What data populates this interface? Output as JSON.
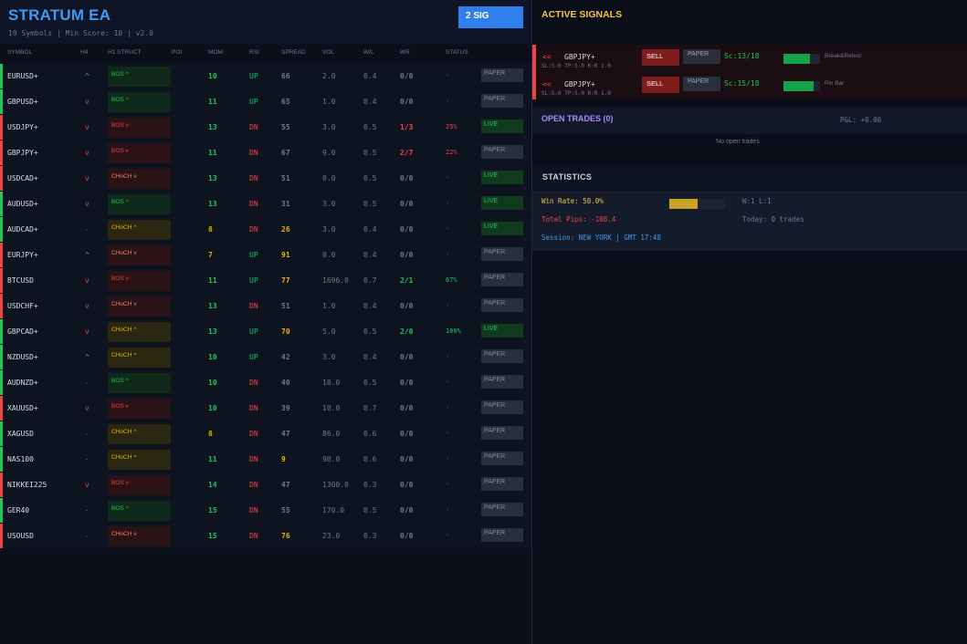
{
  "header": {
    "title": "STRATUM EA",
    "subtitle": "19 Symbols | Min Score: 10 | v2.0",
    "signal_badge": "2 SIG"
  },
  "columns": [
    "SYMBOL",
    "H4",
    "H1 STRUCT",
    "POI",
    "MOM",
    "RSI",
    "SPREAD",
    "VOL",
    "W/L",
    "WR",
    "STATUS"
  ],
  "rows": [
    {
      "symbol": "EURUSD+",
      "h4": "^",
      "struct": "BOS ^",
      "mom": "10",
      "rsi": "UP",
      "spread": "66",
      "vol": "2.0",
      "wl": "0.4",
      "wr": "0/0",
      "pct": "-",
      "status": "PAPER"
    },
    {
      "symbol": "GBPUSD+",
      "h4": "v",
      "struct": "BOS ^",
      "mom": "11",
      "rsi": "UP",
      "spread": "65",
      "vol": "1.0",
      "wl": "0.4",
      "wr": "0/0",
      "pct": "-",
      "status": "PAPER"
    },
    {
      "symbol": "USDJPY+",
      "h4": "v",
      "struct": "BOS v",
      "mom": "13",
      "rsi": "DN",
      "spread": "55",
      "vol": "3.0",
      "wl": "0.5",
      "wr": "1/3",
      "pct": "25%",
      "status": "LIVE"
    },
    {
      "symbol": "GBPJPY+",
      "h4": "v",
      "struct": "BOS v",
      "mom": "11",
      "rsi": "DN",
      "spread": "67",
      "vol": "9.0",
      "wl": "0.5",
      "wr": "2/7",
      "pct": "22%",
      "status": "PAPER"
    },
    {
      "symbol": "USDCAD+",
      "h4": "v",
      "struct": "CHoCH v",
      "mom": "13",
      "rsi": "DN",
      "spread": "51",
      "vol": "0.0",
      "wl": "0.5",
      "wr": "0/0",
      "pct": "-",
      "status": "LIVE"
    },
    {
      "symbol": "AUDUSD+",
      "h4": "v",
      "struct": "BOS ^",
      "mom": "13",
      "rsi": "DN",
      "spread": "31",
      "vol": "3.0",
      "wl": "0.5",
      "wr": "0/0",
      "pct": "-",
      "status": "LIVE"
    },
    {
      "symbol": "AUDCAD+",
      "h4": "-",
      "struct": "CHoCH ^",
      "mom": "8",
      "rsi": "DN",
      "spread": "26",
      "vol": "3.0",
      "wl": "0.4",
      "wr": "0/0",
      "pct": "-",
      "status": "LIVE"
    },
    {
      "symbol": "EURJPY+",
      "h4": "^",
      "struct": "CHoCH v",
      "mom": "7",
      "rsi": "UP",
      "spread": "91",
      "vol": "0.0",
      "wl": "0.4",
      "wr": "0/0",
      "pct": "-",
      "status": "PAPER"
    },
    {
      "symbol": "BTCUSD",
      "h4": "v",
      "struct": "BOS v",
      "mom": "11",
      "rsi": "UP",
      "spread": "77",
      "vol": "1696.0",
      "wl": "0.7",
      "wr": "2/1",
      "pct": "67%",
      "status": "PAPER"
    },
    {
      "symbol": "USDCHF+",
      "h4": "v",
      "struct": "CHoCH v",
      "mom": "13",
      "rsi": "DN",
      "spread": "51",
      "vol": "1.0",
      "wl": "0.4",
      "wr": "0/0",
      "pct": "-",
      "status": "PAPER"
    },
    {
      "symbol": "GBPCAD+",
      "h4": "v",
      "struct": "CHoCH ^",
      "mom": "13",
      "rsi": "UP",
      "spread": "70",
      "vol": "5.0",
      "wl": "0.5",
      "wr": "2/0",
      "pct": "100%",
      "status": "LIVE"
    },
    {
      "symbol": "NZDUSD+",
      "h4": "^",
      "struct": "CHoCH ^",
      "mom": "10",
      "rsi": "UP",
      "spread": "42",
      "vol": "3.0",
      "wl": "0.4",
      "wr": "0/0",
      "pct": "-",
      "status": "PAPER"
    },
    {
      "symbol": "AUDNZD+",
      "h4": "-",
      "struct": "BOS ^",
      "mom": "10",
      "rsi": "DN",
      "spread": "40",
      "vol": "10.0",
      "wl": "0.5",
      "wr": "0/0",
      "pct": "-",
      "status": "PAPER"
    },
    {
      "symbol": "XAUUSD+",
      "h4": "v",
      "struct": "BOS v",
      "mom": "10",
      "rsi": "DN",
      "spread": "39",
      "vol": "10.0",
      "wl": "0.7",
      "wr": "0/0",
      "pct": "-",
      "status": "PAPER"
    },
    {
      "symbol": "XAGUSD",
      "h4": "-",
      "struct": "CHoCH ^",
      "mom": "8",
      "rsi": "DN",
      "spread": "47",
      "vol": "86.0",
      "wl": "0.6",
      "wr": "0/0",
      "pct": "-",
      "status": "PAPER"
    },
    {
      "symbol": "NAS100",
      "h4": "-",
      "struct": "CHoCH ^",
      "mom": "11",
      "rsi": "DN",
      "spread": "9",
      "vol": "90.0",
      "wl": "0.6",
      "wr": "0/0",
      "pct": "-",
      "status": "PAPER"
    },
    {
      "symbol": "NIKKEI225",
      "h4": "v",
      "struct": "BOS v",
      "mom": "14",
      "rsi": "DN",
      "spread": "47",
      "vol": "1300.0",
      "wl": "0.3",
      "wr": "0/0",
      "pct": "-",
      "status": "PAPER"
    },
    {
      "symbol": "GER40",
      "h4": "-",
      "struct": "BOS ^",
      "mom": "15",
      "rsi": "DN",
      "spread": "55",
      "vol": "170.0",
      "wl": "0.5",
      "wr": "0/0",
      "pct": "-",
      "status": "PAPER"
    },
    {
      "symbol": "USOUSD",
      "h4": "-",
      "struct": "CHoCH v",
      "mom": "15",
      "rsi": "DN",
      "spread": "76",
      "vol": "23.0",
      "wl": "0.3",
      "wr": "0/0",
      "pct": "-",
      "status": "PAPER"
    }
  ],
  "active_signals": {
    "title": "ACTIVE SIGNALS",
    "items": [
      {
        "arrow": "<<",
        "symbol": "GBPJPY+",
        "details": "SL:5.0  TP:5.0  R:R 1.0",
        "side": "SELL",
        "mode": "PAPER",
        "score": "Sc:13/18",
        "score_fraction": 0.72,
        "pattern": "Break&Retest"
      },
      {
        "arrow": "<<",
        "symbol": "GBPJPY+",
        "details": "SL:5.0  TP:5.0  R:R 1.0",
        "side": "SELL",
        "mode": "PAPER",
        "score": "Sc:15/18",
        "score_fraction": 0.83,
        "pattern": "Pin Bar"
      }
    ]
  },
  "open_trades": {
    "title": "OPEN TRADES (0)",
    "pnl": "P&L: +0.00",
    "empty_text": "No open trades"
  },
  "statistics": {
    "title": "STATISTICS",
    "win_rate": "Win Rate: 50.0%",
    "win_rate_fraction": 0.5,
    "wl": "W:1  L:1",
    "total_pips": "Total Pips: -108.4",
    "today": "Today: 0 trades",
    "session": "Session: NEW YORK  |  GMT 17:48"
  },
  "colors": {
    "accent": "#3d9bf5",
    "bull": "#22c55e",
    "bear": "#ef4444",
    "warn": "#eab308",
    "purple": "#a78bfa"
  }
}
